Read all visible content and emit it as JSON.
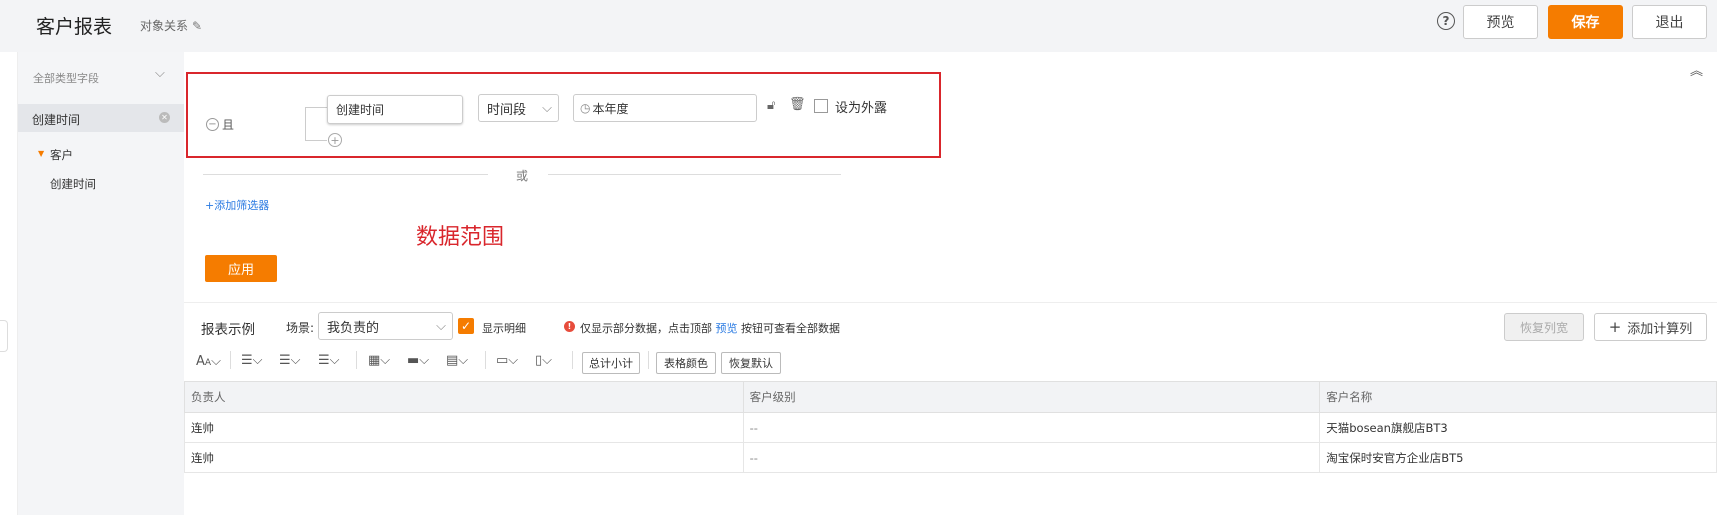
{
  "header": {
    "title": "客户报表",
    "object_relation": "对象关系",
    "help": "?",
    "preview": "预览",
    "save": "保存",
    "exit": "退出"
  },
  "sidebar": {
    "all_fields": "全部类型字段",
    "selected_field": "创建时间",
    "group": "客户",
    "group_item": "创建时间"
  },
  "filter": {
    "logic": "且",
    "field": "创建时间",
    "operator": "时间段",
    "value": "本年度",
    "expose_label": "设为外露",
    "or_label": "或",
    "add_filter": "+添加筛选器",
    "annotation": "数据范围",
    "apply": "应用"
  },
  "report": {
    "title": "报表示例",
    "scene_label": "场景:",
    "scene_value": "我负责的",
    "show_detail": "显示明细",
    "notice_prefix": "仅显示部分数据，点击顶部",
    "notice_link": "预览",
    "notice_suffix": "按钮可查看全部数据",
    "restore_width": "恢复列宽",
    "add_calc_column": "添加计算列",
    "subtotal": "总计小计",
    "table_color": "表格颜色",
    "restore_default": "恢复默认"
  },
  "table": {
    "columns": [
      "负责人",
      "客户级别",
      "客户名称"
    ],
    "rows": [
      [
        "连帅",
        "--",
        "天猫bosean旗舰店BT3"
      ],
      [
        "连帅",
        "--",
        "淘宝保时安官方企业店BT5"
      ]
    ]
  },
  "colors": {
    "accent": "#f57c00",
    "link": "#2a7ae2",
    "annotation": "#d9262c"
  }
}
